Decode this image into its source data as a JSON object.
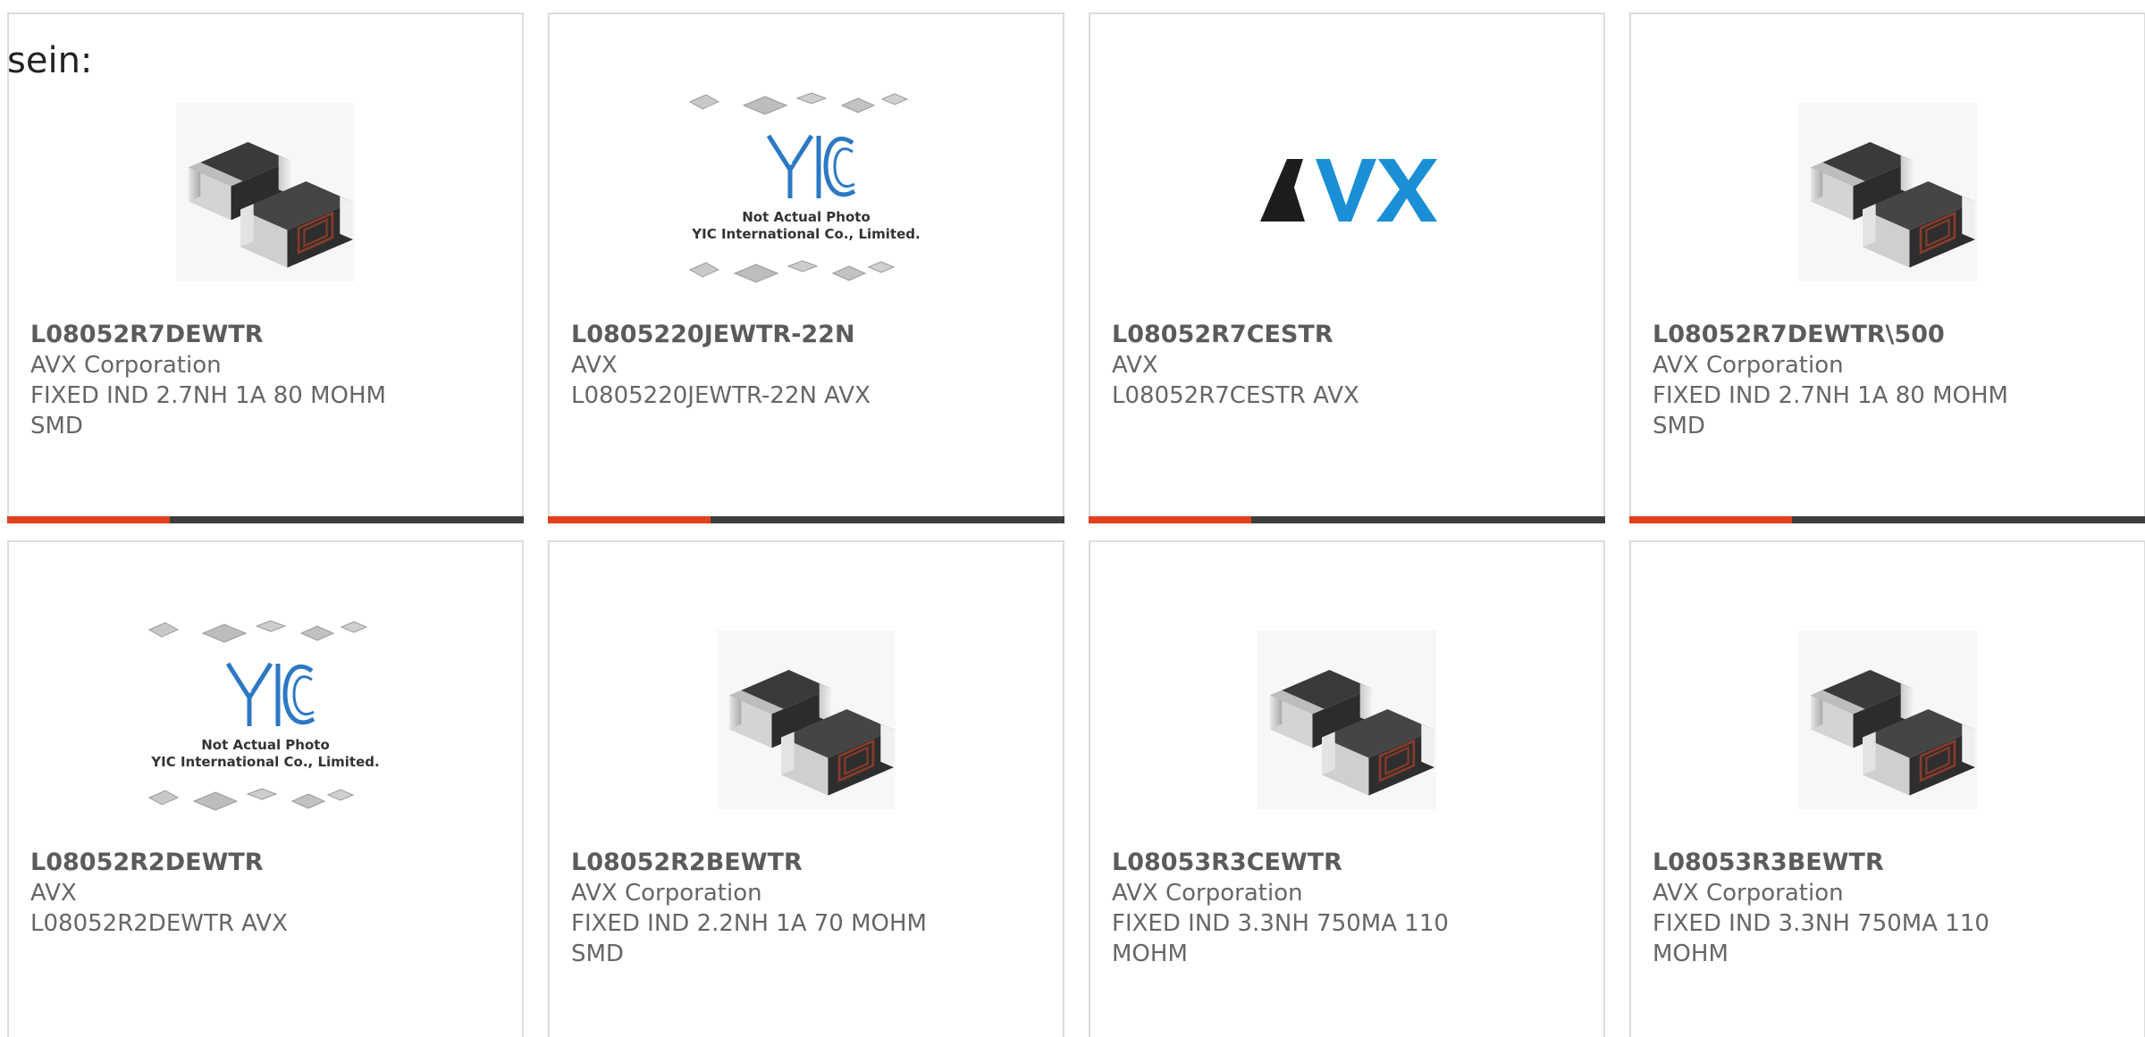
{
  "lead_text": "sein:",
  "colors": {
    "accent": "#e2401c",
    "bar": "#3d3d3d",
    "yic_blue": "#2c78c4",
    "avx_blue": "#1a8fd6"
  },
  "products": [
    {
      "part": "L08052R7DEWTR",
      "maker": "AVX Corporation",
      "desc": "FIXED IND 2.7NH 1A 80 MOHM SMD",
      "image": "smd-inductor-image"
    },
    {
      "part": "L0805220JEWTR-22N",
      "maker": "AVX",
      "desc": "L0805220JEWTR-22N AVX",
      "image": "yic-placeholder-image",
      "image_caption": [
        "Not Actual Photo",
        "YIC International Co., Limited."
      ]
    },
    {
      "part": "L08052R7CESTR",
      "maker": "AVX",
      "desc": "L08052R7CESTR AVX",
      "image": "avx-logo-image",
      "logo_text": "AVX"
    },
    {
      "part": "L08052R7DEWTR\\500",
      "maker": "AVX Corporation",
      "desc": "FIXED IND 2.7NH 1A 80 MOHM SMD",
      "image": "smd-inductor-image"
    },
    {
      "part": "L08052R2DEWTR",
      "maker": "AVX",
      "desc": "L08052R2DEWTR AVX",
      "image": "yic-placeholder-image",
      "image_caption": [
        "Not Actual Photo",
        "YIC International Co., Limited."
      ]
    },
    {
      "part": "L08052R2BEWTR",
      "maker": "AVX Corporation",
      "desc": "FIXED IND 2.2NH 1A 70 MOHM SMD",
      "image": "smd-inductor-image"
    },
    {
      "part": "L08053R3CEWTR",
      "maker": "AVX Corporation",
      "desc": "FIXED IND 3.3NH 750MA 110 MOHM",
      "image": "smd-inductor-image"
    },
    {
      "part": "L08053R3BEWTR",
      "maker": "AVX Corporation",
      "desc": "FIXED IND 3.3NH 750MA 110 MOHM",
      "image": "smd-inductor-image"
    }
  ]
}
